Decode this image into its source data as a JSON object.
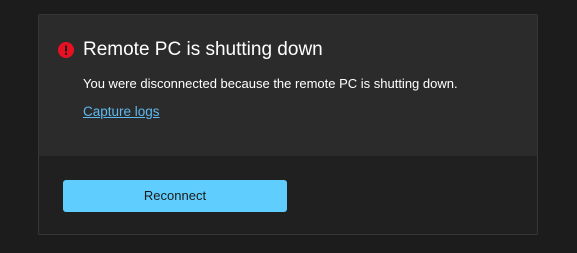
{
  "dialog": {
    "title": "Remote PC is shutting down",
    "message": "You were disconnected because the remote PC is shutting down.",
    "link_label": "Capture logs",
    "icon": "error-icon",
    "primary_button_label": "Reconnect"
  },
  "colors": {
    "accent": "#60cdff",
    "error": "#e81123",
    "link": "#5db9f0",
    "dialog_bg": "#2b2b2b",
    "footer_bg": "#202020",
    "page_bg": "#1c1c1c"
  }
}
